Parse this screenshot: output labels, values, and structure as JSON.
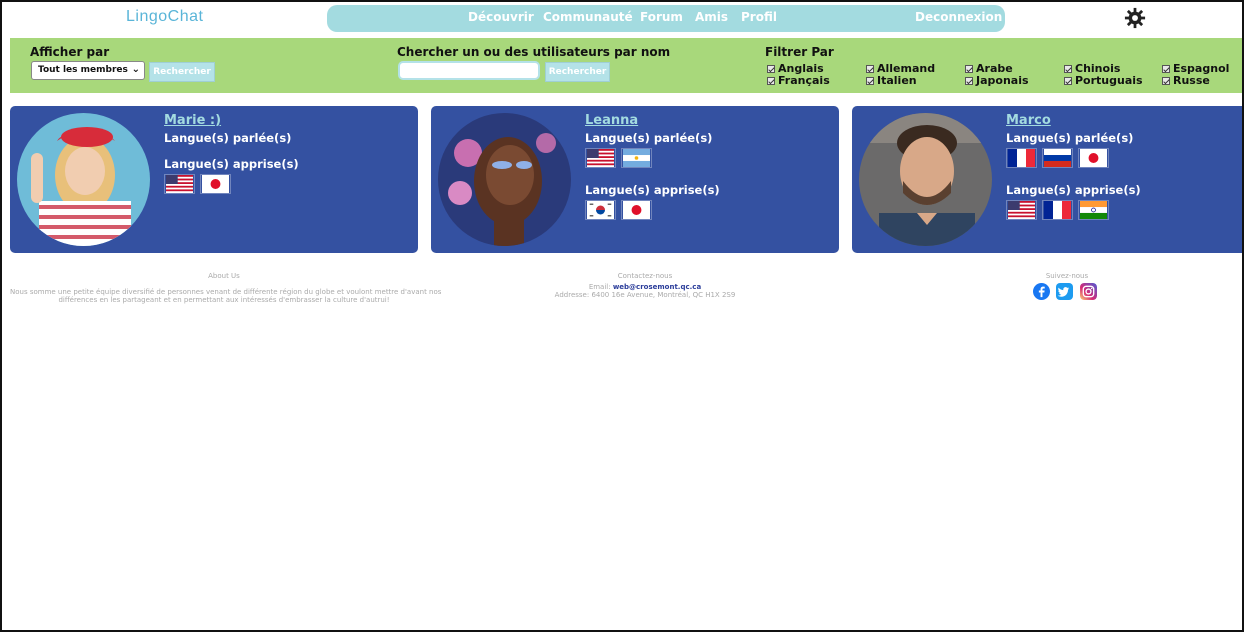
{
  "header": {
    "logo": "LingoChat",
    "nav": [
      "Découvrir",
      "Communauté",
      "Forum",
      "Amis",
      "Profil"
    ],
    "logout": "Deconnexion",
    "settings_icon": "gear-icon"
  },
  "filters": {
    "display_label": "Afficher par",
    "display_value": "Tout les membres",
    "display_button": "Rechercher",
    "search_label": "Chercher un ou des utilisateurs par nom",
    "search_placeholder": "",
    "search_button": "Rechercher",
    "filter_label": "Filtrer Par",
    "languages": [
      "Anglais",
      "Français",
      "Allemand",
      "Italien",
      "Arabe",
      "Japonais",
      "Chinois",
      "Portuguais",
      "Espagnol",
      "Russe"
    ]
  },
  "cards": [
    {
      "name": "Marie :)",
      "spoken_label": "Langue(s) parlée(s)",
      "learned_label": "Langue(s) apprise(s)",
      "spoken_flags": [],
      "learned_flags": [
        "usa-flag",
        "japan-flag"
      ]
    },
    {
      "name": "Leanna",
      "spoken_label": "Langue(s) parlée(s)",
      "learned_label": "Langue(s) apprise(s)",
      "spoken_flags": [
        "usa-flag",
        "argentina-flag"
      ],
      "learned_flags": [
        "korea-flag",
        "japan-flag"
      ]
    },
    {
      "name": "Marco",
      "spoken_label": "Langue(s) parlée(s)",
      "learned_label": "Langue(s) apprise(s)",
      "spoken_flags": [
        "france-flag",
        "russia-flag",
        "japan-flag"
      ],
      "learned_flags": [
        "usa-flag",
        "france-flag",
        "india-flag"
      ]
    }
  ],
  "footer": {
    "about_title": "About Us",
    "about_line1": "Nous somme une petite équipe diversifié de personnes venant de différente région du globe et voulont mettre d'avant nos",
    "about_line2": "différences en les partageant et en permettant aux intéressés d'embrasser la culture d'autrui!",
    "contact_title": "Contactez-nous",
    "email_label": "Email:",
    "email": "web@crosemont.qc.ca",
    "address": "Addresse: 6400 16e Avenue, Montréal, QC H1X 2S9",
    "follow_title": "Suivez-nous",
    "social": [
      "facebook-icon",
      "twitter-icon",
      "instagram-icon"
    ]
  },
  "colors": {
    "accent": "#a3dbe0",
    "filterbar": "#a8d87b",
    "card": "#3451a1"
  }
}
